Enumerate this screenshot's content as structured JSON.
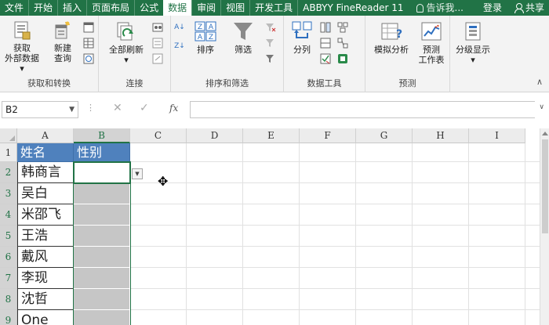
{
  "tabs": [
    "文件",
    "开始",
    "插入",
    "页面布局",
    "公式",
    "数据",
    "审阅",
    "视图",
    "开发工具",
    "ABBYY FineReader 11"
  ],
  "active_tab": "数据",
  "tell_me": "告诉我...",
  "login": "登录",
  "share": "共享",
  "ribbon": {
    "external": {
      "line1": "获取",
      "line2": "外部数据"
    },
    "new_query": {
      "line1": "新建",
      "line2": "查询"
    },
    "group1_title": "获取和转换",
    "refresh_all": "全部刷新",
    "group2_title": "连接",
    "sort": "排序",
    "filter": "筛选",
    "group3_title": "排序和筛选",
    "text_to_cols": "分列",
    "group4_title": "数据工具",
    "whatif": "模拟分析",
    "forecast": {
      "line1": "预测",
      "line2": "工作表"
    },
    "group5_title": "预测",
    "outline": "分级显示"
  },
  "formula_bar": {
    "name_box": "B2",
    "fx": "fx",
    "formula": ""
  },
  "columns": [
    "A",
    "B",
    "C",
    "D",
    "E",
    "F",
    "G",
    "H",
    "I"
  ],
  "rows": [
    "1",
    "2",
    "3",
    "4",
    "5",
    "6",
    "7",
    "8",
    "9"
  ],
  "sheet": {
    "header_name": "姓名",
    "header_gender": "性别",
    "names": [
      "韩商言",
      "吴白",
      "米邵飞",
      "王浩",
      "戴风",
      "李现",
      "沈哲",
      "One"
    ]
  },
  "selected_cell": "B2",
  "colors": {
    "accent": "#217346",
    "header_fill": "#4f81bd",
    "gray_fill": "#c6c6c6"
  }
}
